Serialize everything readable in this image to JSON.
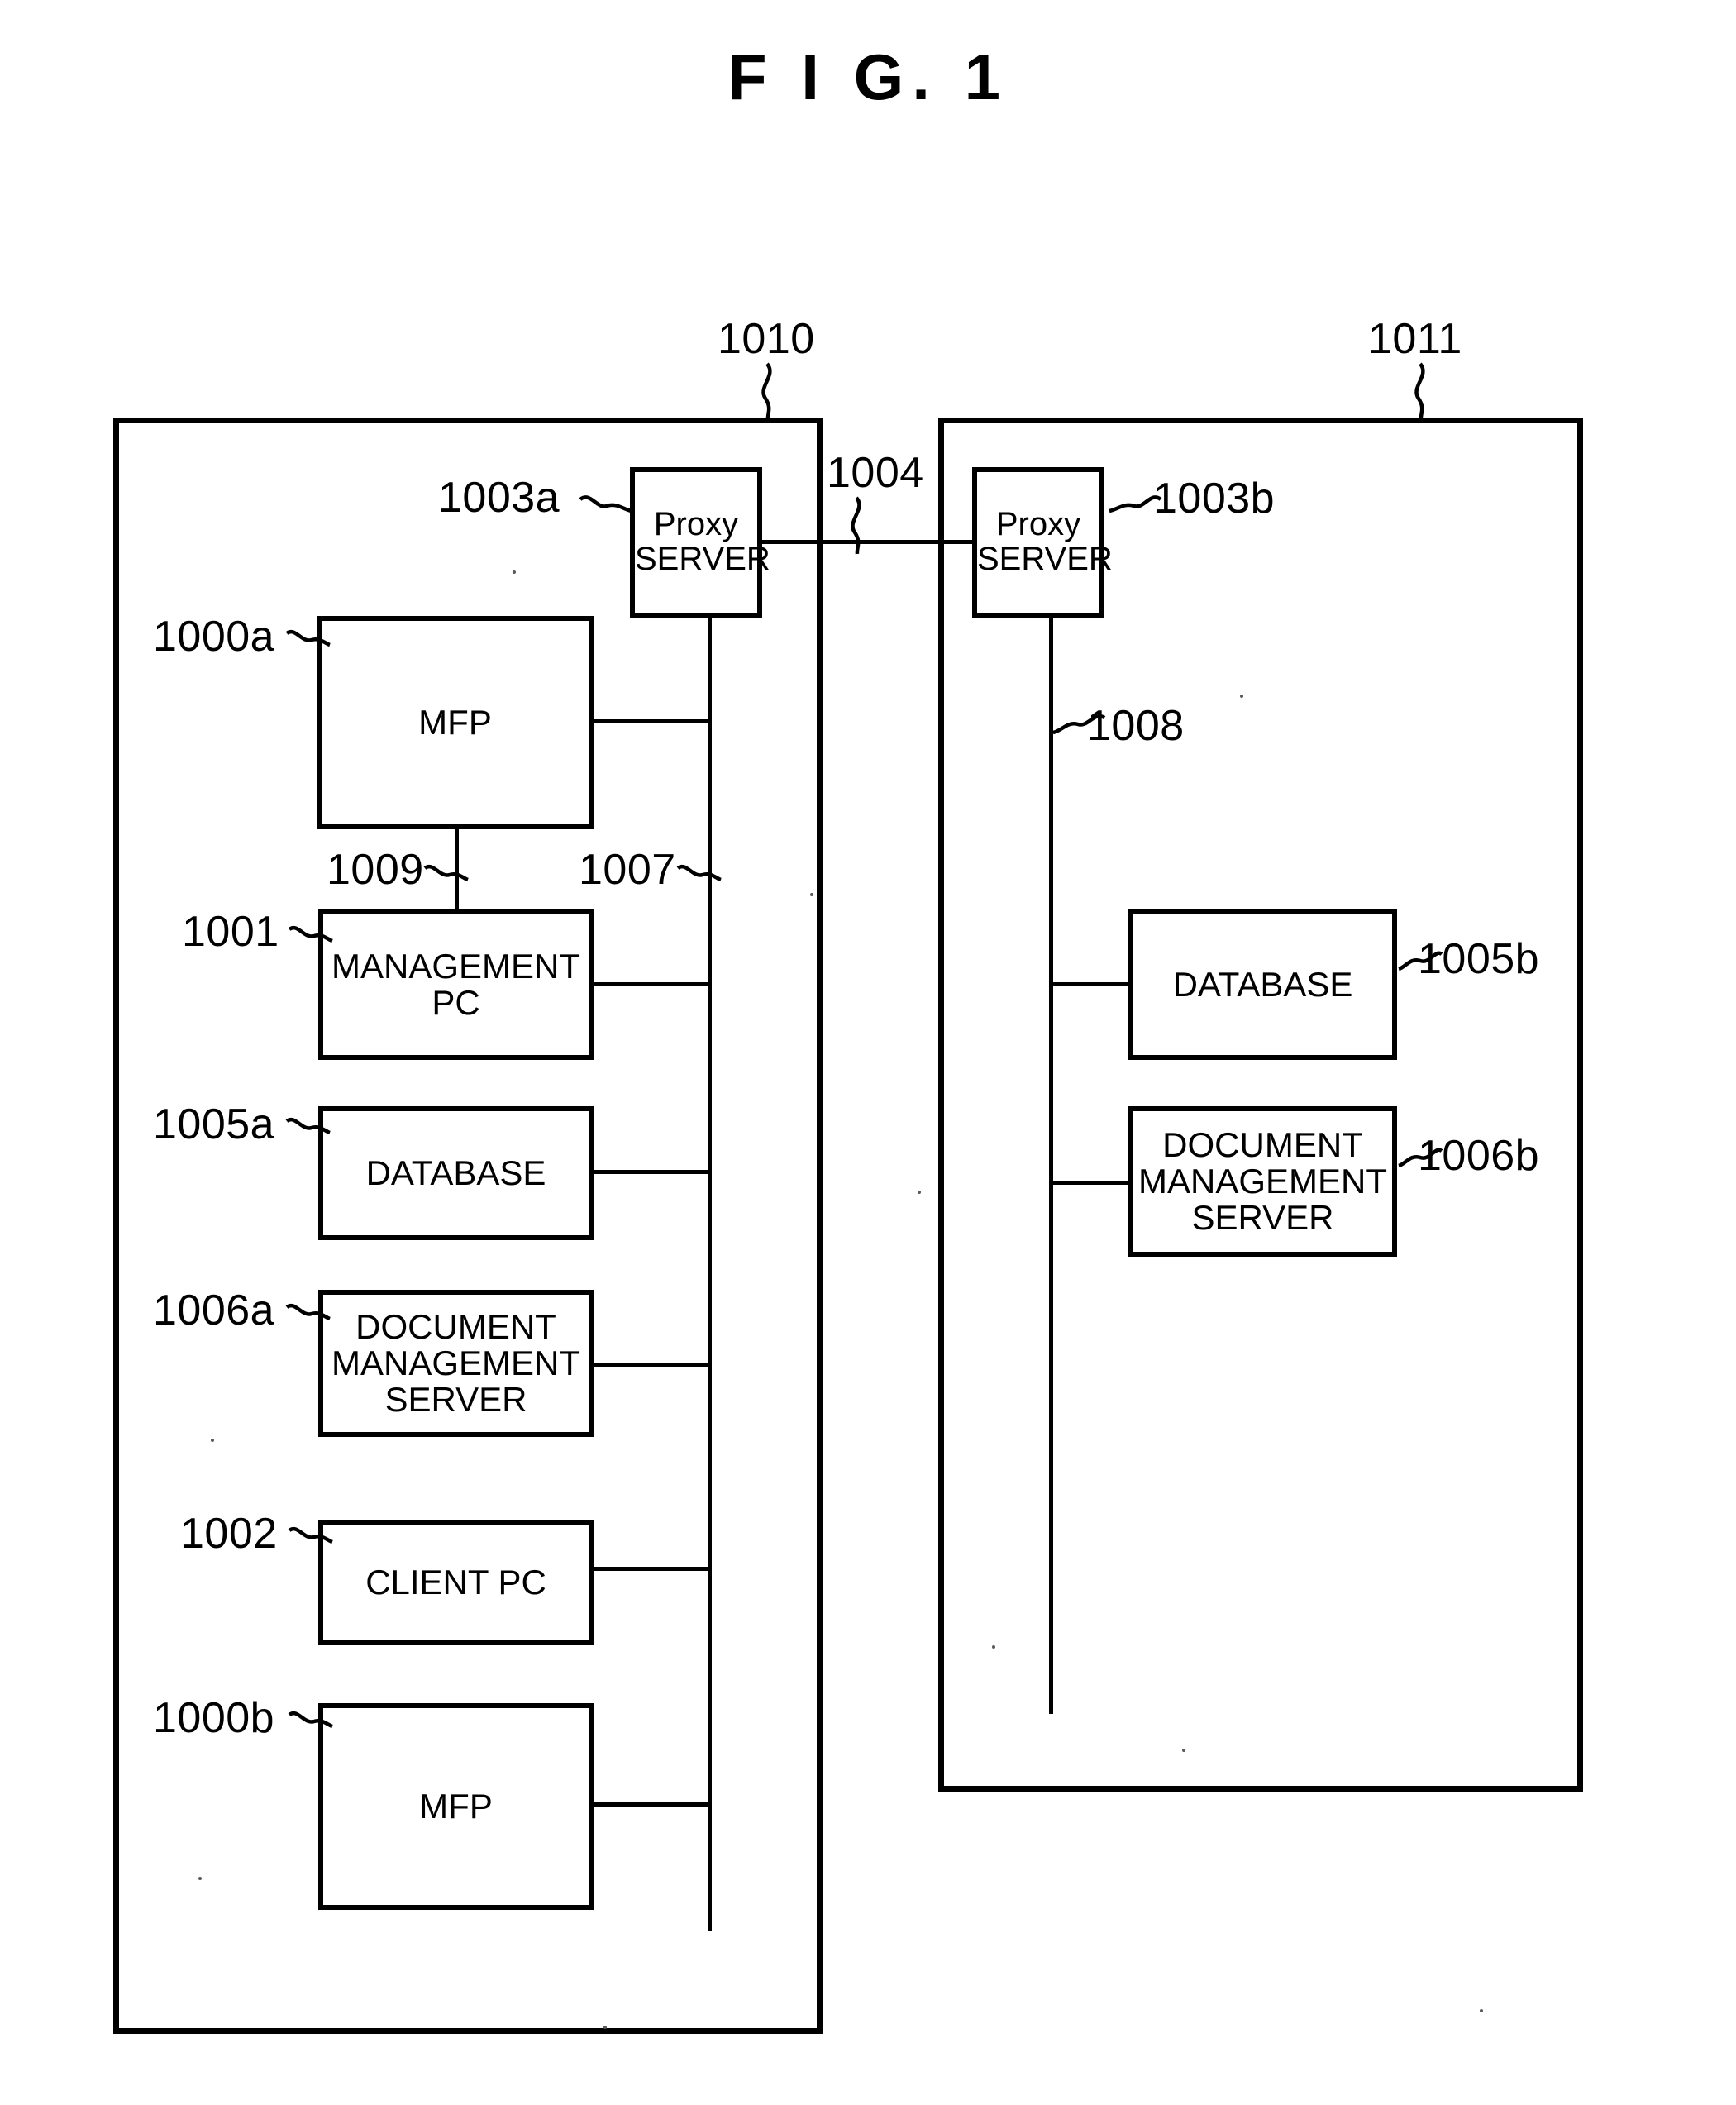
{
  "figure": {
    "title": "F I G.  1"
  },
  "containers": [
    {
      "id": "1010",
      "label": "1010"
    },
    {
      "id": "1011",
      "label": "1011"
    }
  ],
  "nodes": {
    "proxy_a": {
      "ref": "1003a",
      "line1": "Proxy",
      "line2": "SERVER"
    },
    "proxy_b": {
      "ref": "1003b",
      "line1": "Proxy",
      "line2": "SERVER"
    },
    "mfp_a": {
      "ref": "1000a",
      "label": "MFP"
    },
    "mgmt_pc": {
      "ref": "1001",
      "line1": "MANAGEMENT",
      "line2": "PC"
    },
    "db_a": {
      "ref": "1005a",
      "label": "DATABASE"
    },
    "docsrv_a": {
      "ref": "1006a",
      "line1": "DOCUMENT",
      "line2": "MANAGEMENT",
      "line3": "SERVER"
    },
    "client": {
      "ref": "1002",
      "label": "CLIENT PC"
    },
    "mfp_b": {
      "ref": "1000b",
      "label": "MFP"
    },
    "db_b": {
      "ref": "1005b",
      "label": "DATABASE"
    },
    "docsrv_b": {
      "ref": "1006b",
      "line1": "DOCUMENT",
      "line2": "MANAGEMENT",
      "line3": "SERVER"
    }
  },
  "connections": {
    "inter_proxy": {
      "ref": "1004"
    },
    "bus_left": {
      "ref": "1007"
    },
    "bus_right": {
      "ref": "1008"
    },
    "mfp_to_mgmt": {
      "ref": "1009"
    }
  },
  "colors": {
    "ink": "#000000",
    "paper": "#ffffff"
  }
}
